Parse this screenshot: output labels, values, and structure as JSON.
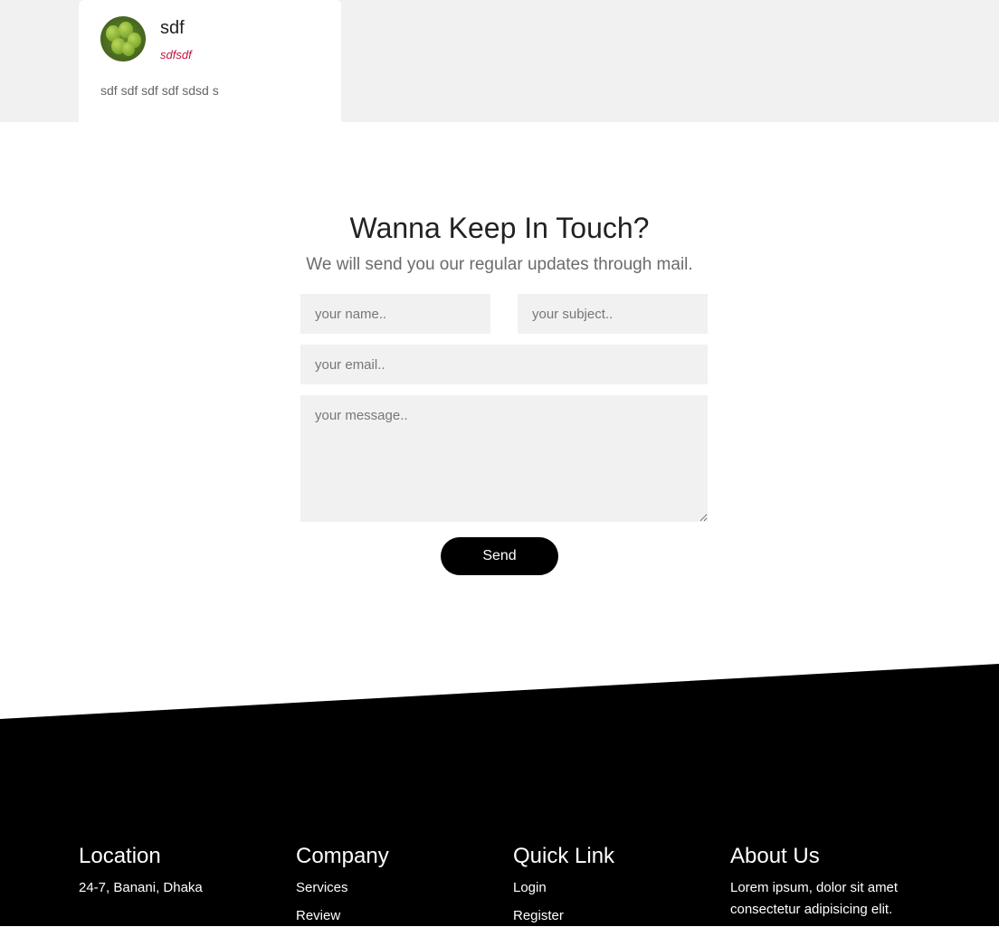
{
  "review": {
    "name": "sdf",
    "role": "sdfsdf",
    "text": "sdf sdf sdf sdf sdsd s"
  },
  "contact": {
    "title": "Wanna Keep In Touch?",
    "subtitle": "We will send you our regular updates through mail.",
    "name_placeholder": "your name..",
    "subject_placeholder": "your subject..",
    "email_placeholder": "your email..",
    "message_placeholder": "your message..",
    "send_label": "Send"
  },
  "footer": {
    "location": {
      "title": "Location",
      "address": "24-7, Banani, Dhaka"
    },
    "company": {
      "title": "Company",
      "links": [
        "Services",
        "Review"
      ]
    },
    "quick_link": {
      "title": "Quick Link",
      "links": [
        "Login",
        "Register"
      ]
    },
    "about": {
      "title": "About Us",
      "text_line1": "Lorem ipsum, dolor sit amet",
      "text_line2": "consectetur adipisicing elit."
    }
  },
  "colors": {
    "footer_bg": "#000000",
    "accent_role": "#c0143c",
    "field_bg": "#f1f1f1"
  }
}
